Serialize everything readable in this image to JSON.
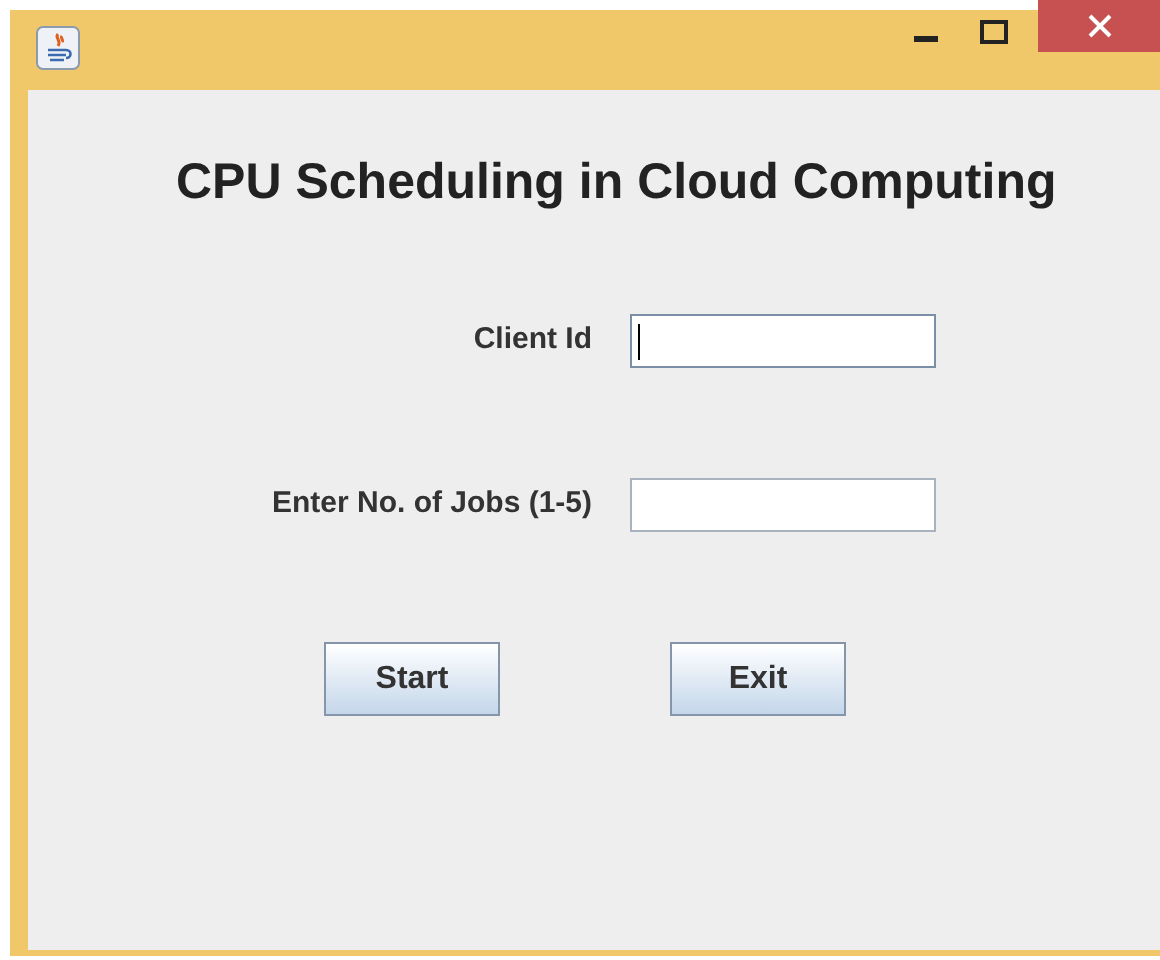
{
  "title": "CPU Scheduling in Cloud Computing",
  "fields": [
    {
      "label": "Client Id",
      "focused": true
    },
    {
      "label": "Enter No. of Jobs (1-5)",
      "focused": false
    }
  ],
  "buttons": [
    "Start",
    "Exit"
  ]
}
